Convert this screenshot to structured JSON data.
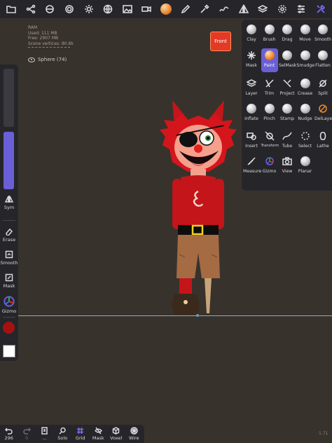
{
  "stats": {
    "ram_label": "RAM",
    "used": "Used: 111 MB",
    "free": "Free: 2907 MB",
    "vertices": "Scene vertices: 80.8k"
  },
  "scene": {
    "object": "Sphere (74)"
  },
  "view_cube": {
    "label": "Front"
  },
  "left_panel": {
    "sym": "Sym",
    "erase": "Erase",
    "smooth": "Smooth",
    "mask": "Mask",
    "gizmo": "Gizmo",
    "main_color": "#a4120f",
    "secondary_color": "#ffffff",
    "radius_fraction": 1.0
  },
  "tools": [
    {
      "label": "Clay",
      "icon": "clay-icon"
    },
    {
      "label": "Brush",
      "icon": "brush-icon"
    },
    {
      "label": "Drag",
      "icon": "drag-icon"
    },
    {
      "label": "Move",
      "icon": "move-icon"
    },
    {
      "label": "Smooth",
      "icon": "smooth-icon"
    },
    {
      "label": "Mask",
      "icon": "mask-icon"
    },
    {
      "label": "Paint",
      "icon": "paint-icon",
      "selected": true
    },
    {
      "label": "SelMask",
      "icon": "selmask-icon"
    },
    {
      "label": "Smudge",
      "icon": "smudge-icon"
    },
    {
      "label": "Flatten",
      "icon": "flatten-icon"
    },
    {
      "label": "Layer",
      "icon": "layer-icon"
    },
    {
      "label": "Trim",
      "icon": "trim-icon"
    },
    {
      "label": "Project",
      "icon": "project-icon"
    },
    {
      "label": "Crease",
      "icon": "crease-icon"
    },
    {
      "label": "Split",
      "icon": "split-icon"
    },
    {
      "label": "Inflate",
      "icon": "inflate-icon"
    },
    {
      "label": "Pinch",
      "icon": "pinch-icon"
    },
    {
      "label": "Stamp",
      "icon": "stamp-icon"
    },
    {
      "label": "Nudge",
      "icon": "nudge-icon"
    },
    {
      "label": "DelLayer",
      "icon": "dellayer-icon"
    },
    {
      "label": "Insert",
      "icon": "insert-icon"
    },
    {
      "label": "Transform",
      "icon": "transform-icon"
    },
    {
      "label": "Tube",
      "icon": "tube-icon"
    },
    {
      "label": "Select",
      "icon": "select-icon"
    },
    {
      "label": "Lathe",
      "icon": "lathe-icon"
    },
    {
      "label": "Measure",
      "icon": "measure-icon"
    },
    {
      "label": "Gizmo",
      "icon": "gizmo-icon"
    },
    {
      "label": "View",
      "icon": "view-icon"
    },
    {
      "label": "Planar",
      "icon": "planar-icon"
    }
  ],
  "bottom": {
    "undo_count": "296",
    "redo_count": "0",
    "menu": "...",
    "solo": "Solo",
    "grid": "Grid",
    "mask": "Mask",
    "voxel": "Voxel",
    "wire": "Wire"
  },
  "version": "1.71"
}
